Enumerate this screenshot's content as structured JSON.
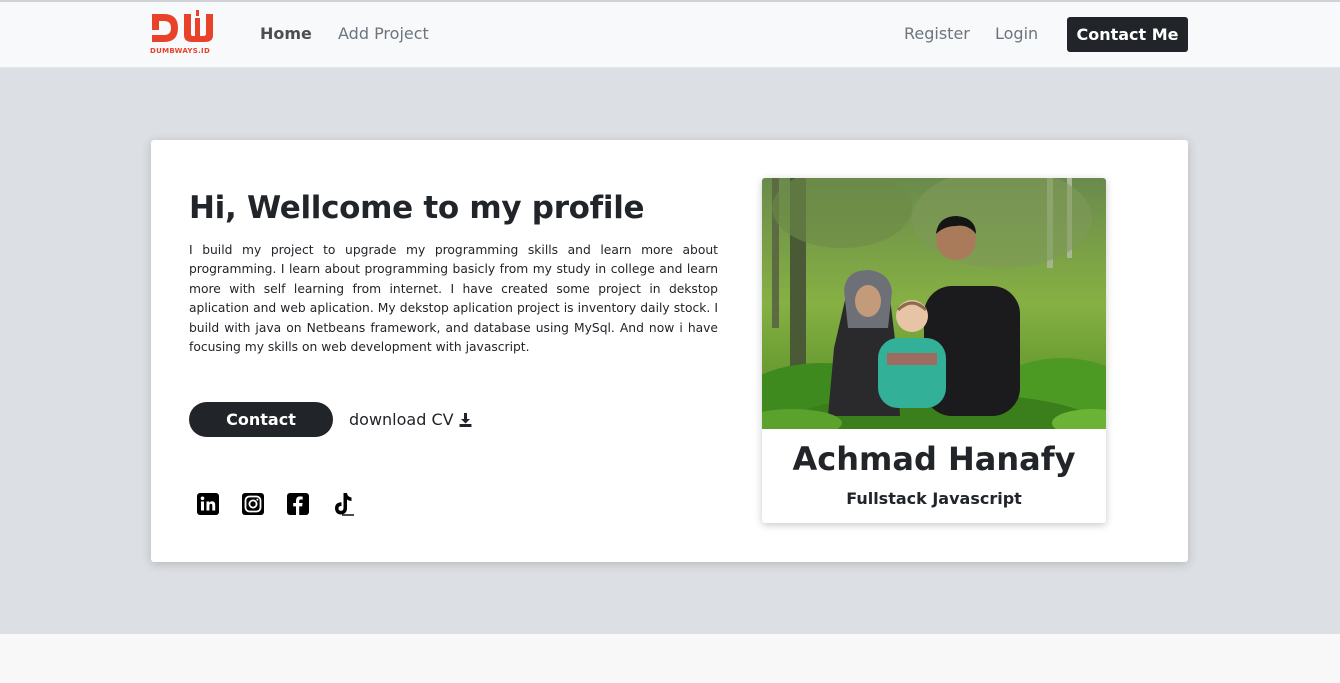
{
  "brand": {
    "logo_text": "DUMBWAYS.ID",
    "logo_color": "#e8422b"
  },
  "nav": {
    "home": "Home",
    "add_project": "Add Project",
    "register": "Register",
    "login": "Login",
    "contact_me": "Contact Me"
  },
  "hero": {
    "headline": "Hi, Wellcome to my profile",
    "bio": "I build my project to upgrade my programming skills and learn more about programming. I learn about programming basicly from my study in college and learn more with self learning from internet. I have created some project in dekstop aplication and web aplication. My dekstop aplication project is inventory daily stock. I build with java on Netbeans framework, and database using MySql. And now i have focusing my skills on web development with javascript.",
    "contact_button": "Contact",
    "download_cv": "download CV",
    "download_icon": "download-icon",
    "socials": [
      "linkedin-icon",
      "instagram-icon",
      "facebook-icon",
      "tiktok-icon"
    ]
  },
  "profile": {
    "name": "Achmad Hanafy",
    "role": "Fullstack Javascript"
  },
  "colors": {
    "dark": "#212529",
    "hero_bg": "#dcdfe3",
    "navbar_bg": "#f8f9fa"
  }
}
